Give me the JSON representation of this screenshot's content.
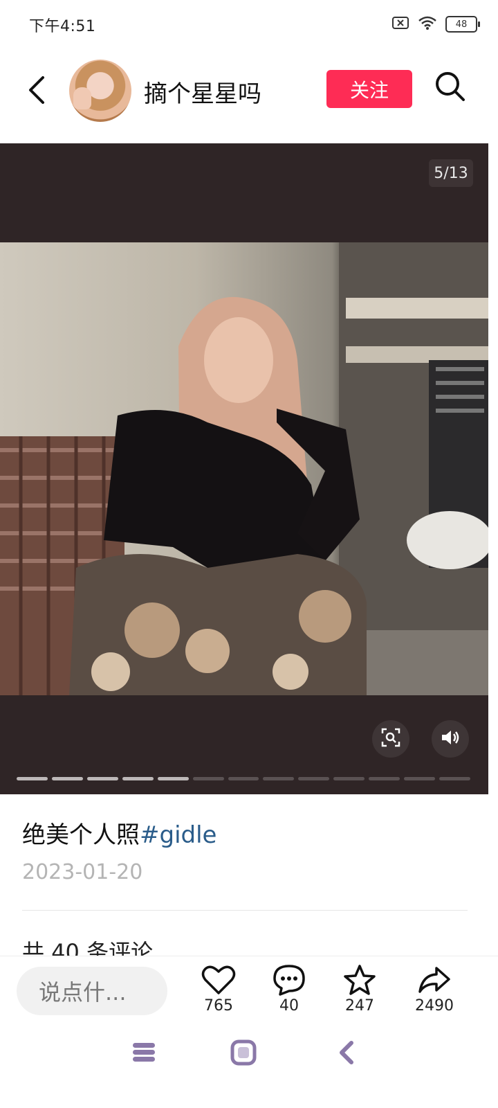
{
  "status_bar": {
    "time": "下午4:51",
    "battery": "48",
    "icons": [
      "notification-blocked-icon",
      "wifi-icon",
      "battery-icon"
    ]
  },
  "header": {
    "username": "摘个星星吗",
    "follow_label": "关注",
    "icons": [
      "back-arrow-icon",
      "search-icon"
    ]
  },
  "media": {
    "page_counter": "5/13",
    "current_page": 5,
    "total_pages": 13,
    "icons": [
      "image-search-icon",
      "volume-icon"
    ]
  },
  "post": {
    "caption": "绝美个人照",
    "hashtag": "#gidle",
    "date": "2023-01-20",
    "comments_header": "共 40 条评论"
  },
  "action_bar": {
    "comment_placeholder": "说点什...",
    "like_count": "765",
    "comment_count": "40",
    "favorite_count": "247",
    "share_count": "2490"
  },
  "colors": {
    "accent": "#fe2c55",
    "hashtag": "#2a5c8a",
    "media_background": "#2f2526",
    "nav_icon": "#8a78a8"
  }
}
